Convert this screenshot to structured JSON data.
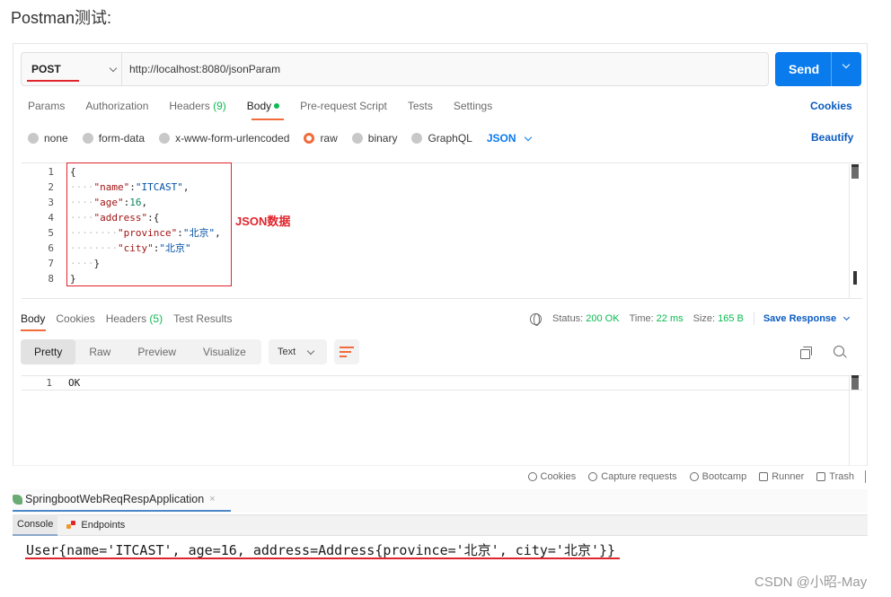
{
  "page": {
    "heading": "Postman测试:"
  },
  "request": {
    "method": "POST",
    "url": "http://localhost:8080/jsonParam",
    "send_label": "Send"
  },
  "request_tabs": {
    "params": "Params",
    "authorization": "Authorization",
    "headers": "Headers",
    "headers_count": "(9)",
    "body": "Body",
    "pre_request": "Pre-request Script",
    "tests": "Tests",
    "settings": "Settings",
    "cookies": "Cookies"
  },
  "body_types": {
    "none": "none",
    "form_data": "form-data",
    "urlencoded": "x-www-form-urlencoded",
    "raw": "raw",
    "binary": "binary",
    "graphql": "GraphQL",
    "selected_format": "JSON",
    "beautify": "Beautify"
  },
  "editor": {
    "line_numbers": [
      "1",
      "2",
      "3",
      "4",
      "5",
      "6",
      "7",
      "8"
    ],
    "annotation": "JSON数据",
    "lines": {
      "l1": "{",
      "l2_key": "\"name\"",
      "l2_val": "\"ITCAST\"",
      "l3_key": "\"age\"",
      "l3_val": "16",
      "l4_key": "\"address\"",
      "l5_key": "\"province\"",
      "l5_val": "\"北京\"",
      "l6_key": "\"city\"",
      "l6_val": "\"北京\"",
      "l7": "}",
      "l8": "}"
    }
  },
  "response": {
    "tabs": {
      "body": "Body",
      "cookies": "Cookies",
      "headers": "Headers",
      "headers_count": "(5)",
      "test_results": "Test Results"
    },
    "status_label": "Status:",
    "status_value": "200 OK",
    "time_label": "Time:",
    "time_value": "22 ms",
    "size_label": "Size:",
    "size_value": "165 B",
    "save_response": "Save Response",
    "view_tabs": {
      "pretty": "Pretty",
      "raw": "Raw",
      "preview": "Preview",
      "visualize": "Visualize"
    },
    "format": "Text",
    "line_number": "1",
    "content": "OK"
  },
  "footer": {
    "cookies": "Cookies",
    "capture": "Capture requests",
    "bootcamp": "Bootcamp",
    "runner": "Runner",
    "trash": "Trash"
  },
  "ide": {
    "run_tab": "SpringbootWebReqRespApplication",
    "close": "×",
    "console_tab": "Console",
    "endpoints_tab": "Endpoints",
    "console_output": "User{name='ITCAST', age=16, address=Address{province='北京', city='北京'}}"
  },
  "watermark": "CSDN @小昭-May",
  "colors": {
    "send_blue": "#097bed",
    "accent_orange": "#f26b3a",
    "status_green": "#0cbb52",
    "annotation_red": "#e0242b"
  }
}
